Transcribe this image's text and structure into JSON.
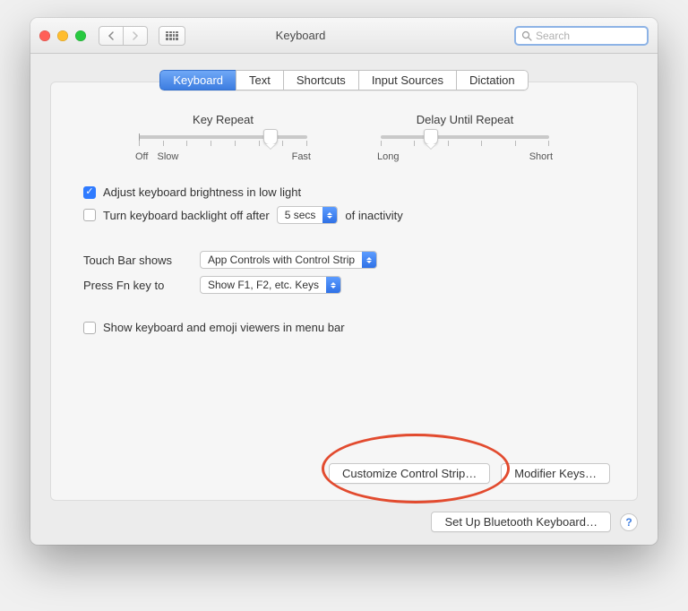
{
  "window": {
    "title": "Keyboard"
  },
  "search": {
    "placeholder": "Search"
  },
  "tabs": [
    "Keyboard",
    "Text",
    "Shortcuts",
    "Input Sources",
    "Dictation"
  ],
  "sliders": {
    "key_repeat": {
      "title": "Key Repeat",
      "labels": {
        "off": "Off",
        "slow": "Slow",
        "fast": "Fast"
      }
    },
    "delay_until_repeat": {
      "title": "Delay Until Repeat",
      "labels": {
        "long": "Long",
        "short": "Short"
      }
    }
  },
  "checkboxes": {
    "adjust_brightness": "Adjust keyboard brightness in low light",
    "backlight_off": {
      "prefix": "Turn keyboard backlight off after",
      "suffix": "of inactivity",
      "value": "5 secs"
    },
    "show_viewers": "Show keyboard and emoji viewers in menu bar"
  },
  "touch_bar": {
    "label": "Touch Bar shows",
    "value": "App Controls with Control Strip"
  },
  "fn_key": {
    "label": "Press Fn key to",
    "value": "Show F1, F2, etc. Keys"
  },
  "buttons": {
    "customize": "Customize Control Strip…",
    "modifier": "Modifier Keys…",
    "bluetooth": "Set Up Bluetooth Keyboard…",
    "help": "?"
  }
}
